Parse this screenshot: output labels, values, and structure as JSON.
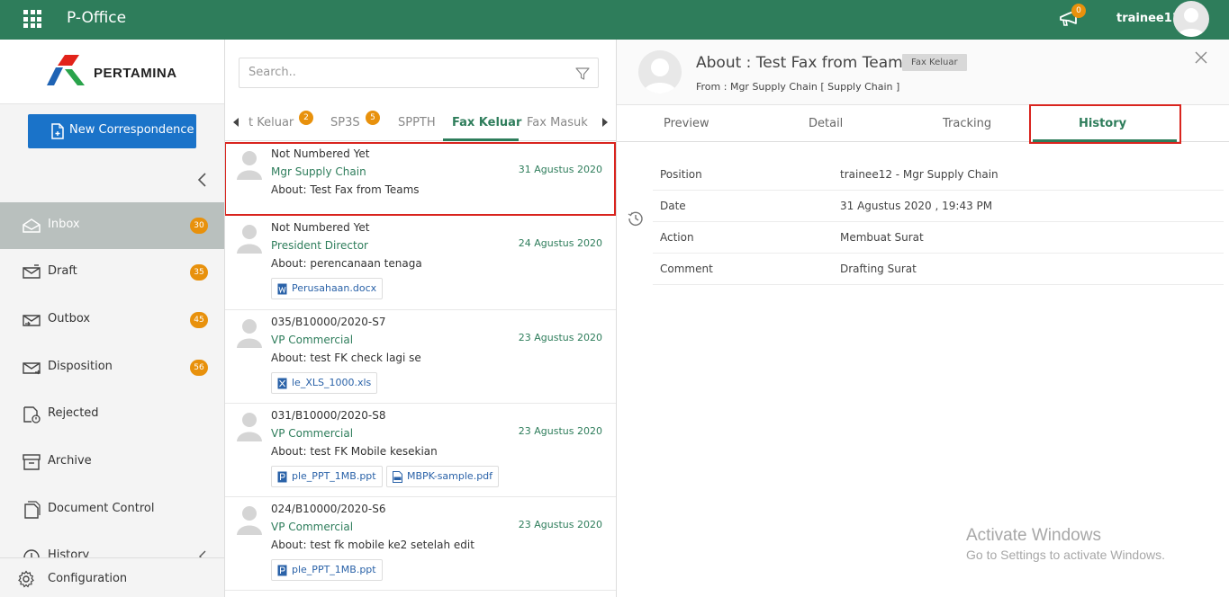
{
  "header": {
    "app_title": "P-Office",
    "notification_count": "0",
    "username": "trainee11"
  },
  "sidebar": {
    "logo_text": "PERTAMINA",
    "new_button": "New Correspondence",
    "items": [
      {
        "label": "Inbox",
        "badge": "30"
      },
      {
        "label": "Draft",
        "badge": "35"
      },
      {
        "label": "Outbox",
        "badge": "45"
      },
      {
        "label": "Disposition",
        "badge": "56"
      },
      {
        "label": "Rejected"
      },
      {
        "label": "Archive"
      },
      {
        "label": "Document Control"
      },
      {
        "label": "History"
      }
    ],
    "configuration": "Configuration"
  },
  "list": {
    "search_placeholder": "Search..",
    "tabs": [
      {
        "label": "t Keluar",
        "badge": "2"
      },
      {
        "label": "SP3S",
        "badge": "5"
      },
      {
        "label": "SPPTH"
      },
      {
        "label": "Fax Keluar"
      },
      {
        "label": "Fax Masuk"
      }
    ],
    "items": [
      {
        "number": "Not Numbered Yet",
        "from": "Mgr Supply Chain",
        "date": "31 Agustus 2020",
        "about": "About: Test Fax from Teams"
      },
      {
        "number": "Not Numbered Yet",
        "from": "President Director",
        "date": "24 Agustus 2020",
        "about": "About: perencanaan tenaga",
        "attachments": [
          "Perusahaan.docx"
        ]
      },
      {
        "number": "035/B10000/2020-S7",
        "from": "VP Commercial",
        "date": "23 Agustus 2020",
        "about": "About: test FK check lagi se",
        "attachments": [
          "le_XLS_1000.xls"
        ]
      },
      {
        "number": "031/B10000/2020-S8",
        "from": "VP Commercial",
        "date": "23 Agustus 2020",
        "about": "About: test FK Mobile kesekian",
        "attachments": [
          "ple_PPT_1MB.ppt",
          "MBPK-sample.pdf"
        ]
      },
      {
        "number": "024/B10000/2020-S6",
        "from": "VP Commercial",
        "date": "23 Agustus 2020",
        "about": "About: test fk mobile ke2 setelah edit",
        "attachments": [
          "ple_PPT_1MB.ppt"
        ]
      }
    ]
  },
  "detail": {
    "title": "About : Test Fax from Teams",
    "type_badge": "Fax Keluar",
    "from": "From : Mgr Supply Chain [ Supply Chain ]",
    "tabs": [
      "Preview",
      "Detail",
      "Tracking",
      "History"
    ],
    "history": [
      {
        "key": "Position",
        "value": "trainee12 - Mgr Supply Chain"
      },
      {
        "key": "Date",
        "value": "31 Agustus 2020 , 19:43 PM"
      },
      {
        "key": "Action",
        "value": "Membuat Surat"
      },
      {
        "key": "Comment",
        "value": "Drafting Surat"
      }
    ]
  },
  "watermark": {
    "line1": "Activate Windows",
    "line2": "Go to Settings to activate Windows."
  },
  "colors": {
    "brand_green": "#2e7d5b",
    "badge_orange": "#e8910c",
    "primary_blue": "#1a73c9",
    "highlight_red": "#d9241e"
  }
}
